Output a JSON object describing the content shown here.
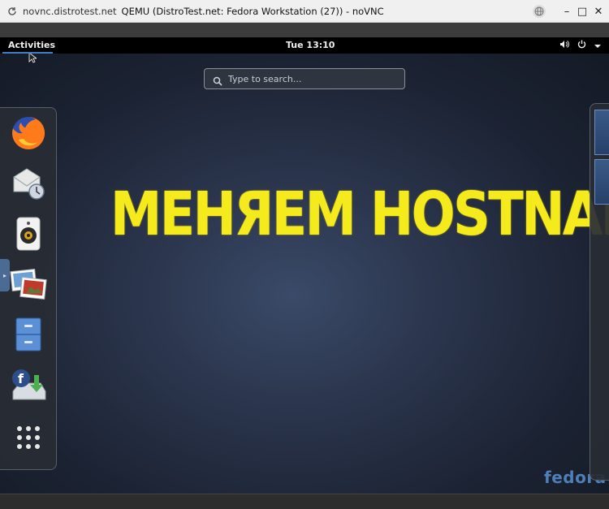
{
  "browser": {
    "url": "novnc.distrotest.net",
    "title": "QEMU (DistroTest.net: Fedora Workstation (27)) - noVNC",
    "minimize": "–",
    "maximize": "□",
    "close": "✕"
  },
  "topbar": {
    "activities": "Activities",
    "clock": "Tue 13:10"
  },
  "search": {
    "placeholder": "Type to search..."
  },
  "dash": {
    "items": [
      {
        "name": "Firefox"
      },
      {
        "name": "Evolution"
      },
      {
        "name": "Rhythmbox"
      },
      {
        "name": "Shotwell"
      },
      {
        "name": "Files"
      },
      {
        "name": "Fedora Media Writer"
      },
      {
        "name": "Show Applications"
      }
    ]
  },
  "wallpaper": {
    "headline": "MEHЯEM HOSTNAME",
    "logo": "fedora"
  },
  "colors": {
    "headline": "#f5ea1c",
    "accent": "#3d7ecf",
    "fedora_logo": "#4f7fb8"
  }
}
